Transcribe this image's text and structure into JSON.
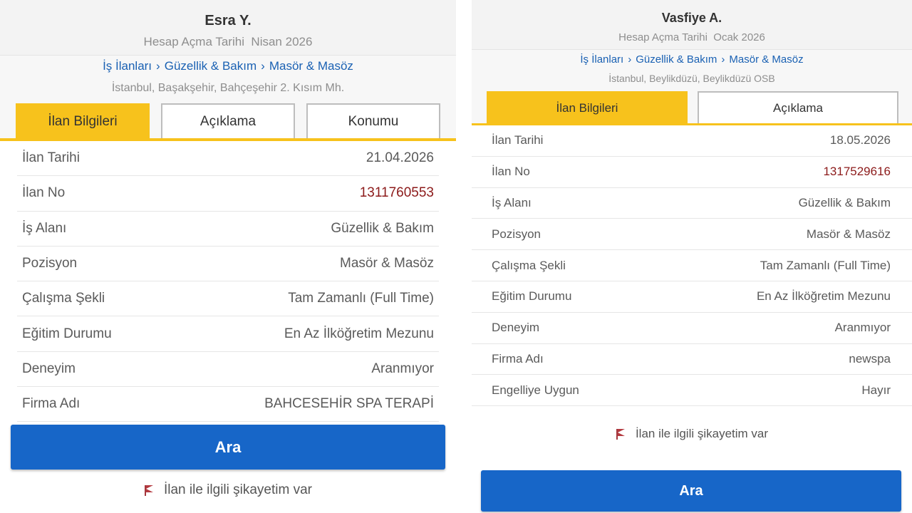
{
  "left": {
    "user_name": "Esra Y.",
    "account_label": "Hesap Açma Tarihi",
    "account_date": "Nisan 2026",
    "breadcrumb": [
      "İş İlanları",
      "Güzellik & Bakım",
      "Masör & Masöz"
    ],
    "breadcrumb_sep": "›",
    "location": "İstanbul, Başakşehir, Bahçeşehir 2. Kısım Mh.",
    "tabs": [
      "İlan Bilgileri",
      "Açıklama",
      "Konumu"
    ],
    "rows": [
      {
        "key": "İlan Tarihi",
        "value": "21.04.2026"
      },
      {
        "key": "İlan No",
        "value": "1311760553"
      },
      {
        "key": "İş Alanı",
        "value": "Güzellik & Bakım"
      },
      {
        "key": "Pozisyon",
        "value": "Masör & Masöz"
      },
      {
        "key": "Çalışma Şekli",
        "value": "Tam Zamanlı (Full Time)"
      },
      {
        "key": "Eğitim Durumu",
        "value": "En Az İlköğretim Mezunu"
      },
      {
        "key": "Deneyim",
        "value": "Aranmıyor"
      },
      {
        "key": "Firma Adı",
        "value": "BAHCESEHİR SPA TERAPİ"
      }
    ],
    "call_label": "Ara",
    "complaint_label": "İlan ile ilgili şikayetim var"
  },
  "right": {
    "user_name": "Vasfiye A.",
    "account_label": "Hesap Açma Tarihi",
    "account_date": "Ocak 2026",
    "breadcrumb": [
      "İş İlanları",
      "Güzellik & Bakım",
      "Masör & Masöz"
    ],
    "breadcrumb_sep": "›",
    "location": "İstanbul, Beylikdüzü, Beylikdüzü OSB",
    "tabs": [
      "İlan Bilgileri",
      "Açıklama"
    ],
    "rows": [
      {
        "key": "İlan Tarihi",
        "value": "18.05.2026"
      },
      {
        "key": "İlan No",
        "value": "1317529616"
      },
      {
        "key": "İş Alanı",
        "value": "Güzellik & Bakım"
      },
      {
        "key": "Pozisyon",
        "value": "Masör & Masöz"
      },
      {
        "key": "Çalışma Şekli",
        "value": "Tam Zamanlı (Full Time)"
      },
      {
        "key": "Eğitim Durumu",
        "value": "En Az İlköğretim Mezunu"
      },
      {
        "key": "Deneyim",
        "value": "Aranmıyor"
      },
      {
        "key": "Firma Adı",
        "value": "newspa"
      },
      {
        "key": "Engelliye Uygun",
        "value": "Hayır"
      }
    ],
    "call_label": "Ara",
    "complaint_label": "İlan ile ilgili şikayetim var"
  },
  "colors": {
    "accent_yellow": "#f7c21c",
    "link_blue": "#1a61b3",
    "button_blue": "#1766c8",
    "listing_no_red": "#8c1a1a",
    "flag_red": "#b43a40"
  },
  "icons": {
    "complaint": "flag-icon"
  }
}
